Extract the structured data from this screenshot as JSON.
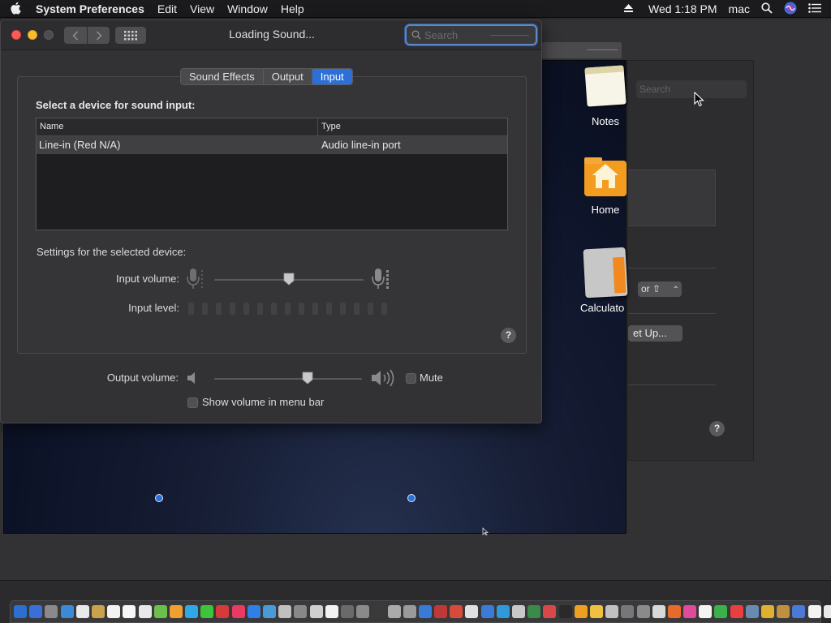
{
  "menubar": {
    "app_name": "System Preferences",
    "items": [
      "Edit",
      "View",
      "Window",
      "Help"
    ],
    "clock": "Wed 1:18 PM",
    "user": "mac"
  },
  "window": {
    "title": "Loading Sound...",
    "search_placeholder": "Search",
    "tabs": [
      {
        "label": "Sound Effects",
        "active": false
      },
      {
        "label": "Output",
        "active": false
      },
      {
        "label": "Input",
        "active": true
      }
    ],
    "input": {
      "select_label": "Select a device for sound input:",
      "columns": [
        "Name",
        "Type"
      ],
      "devices": [
        {
          "name": "Line-in (Red N/A)",
          "type": "Audio line-in port",
          "selected": true
        }
      ],
      "settings_label": "Settings for the selected device:",
      "input_volume_label": "Input volume:",
      "input_volume": 0.5,
      "input_level_label": "Input level:",
      "input_level": 0,
      "help": "?"
    },
    "output_volume_label": "Output volume:",
    "output_volume": 0.63,
    "mute_label": "Mute",
    "mute_checked": false,
    "show_in_menubar_label": "Show volume in menu bar",
    "show_in_menubar_checked": false
  },
  "desktop_icons": [
    {
      "label": "Notes",
      "icon": "notes-icon"
    },
    {
      "label": "Home",
      "icon": "home-folder-icon"
    },
    {
      "label": "Calculato",
      "icon": "calculator-icon"
    }
  ],
  "background_pane": {
    "search_placeholder": "Search",
    "popup_value": "or ⇧",
    "button_label": "et Up...",
    "help": "?"
  },
  "colors": {
    "accent": "#2c6fd6",
    "close": "#fd5c56",
    "minimize": "#fdbc2e"
  }
}
